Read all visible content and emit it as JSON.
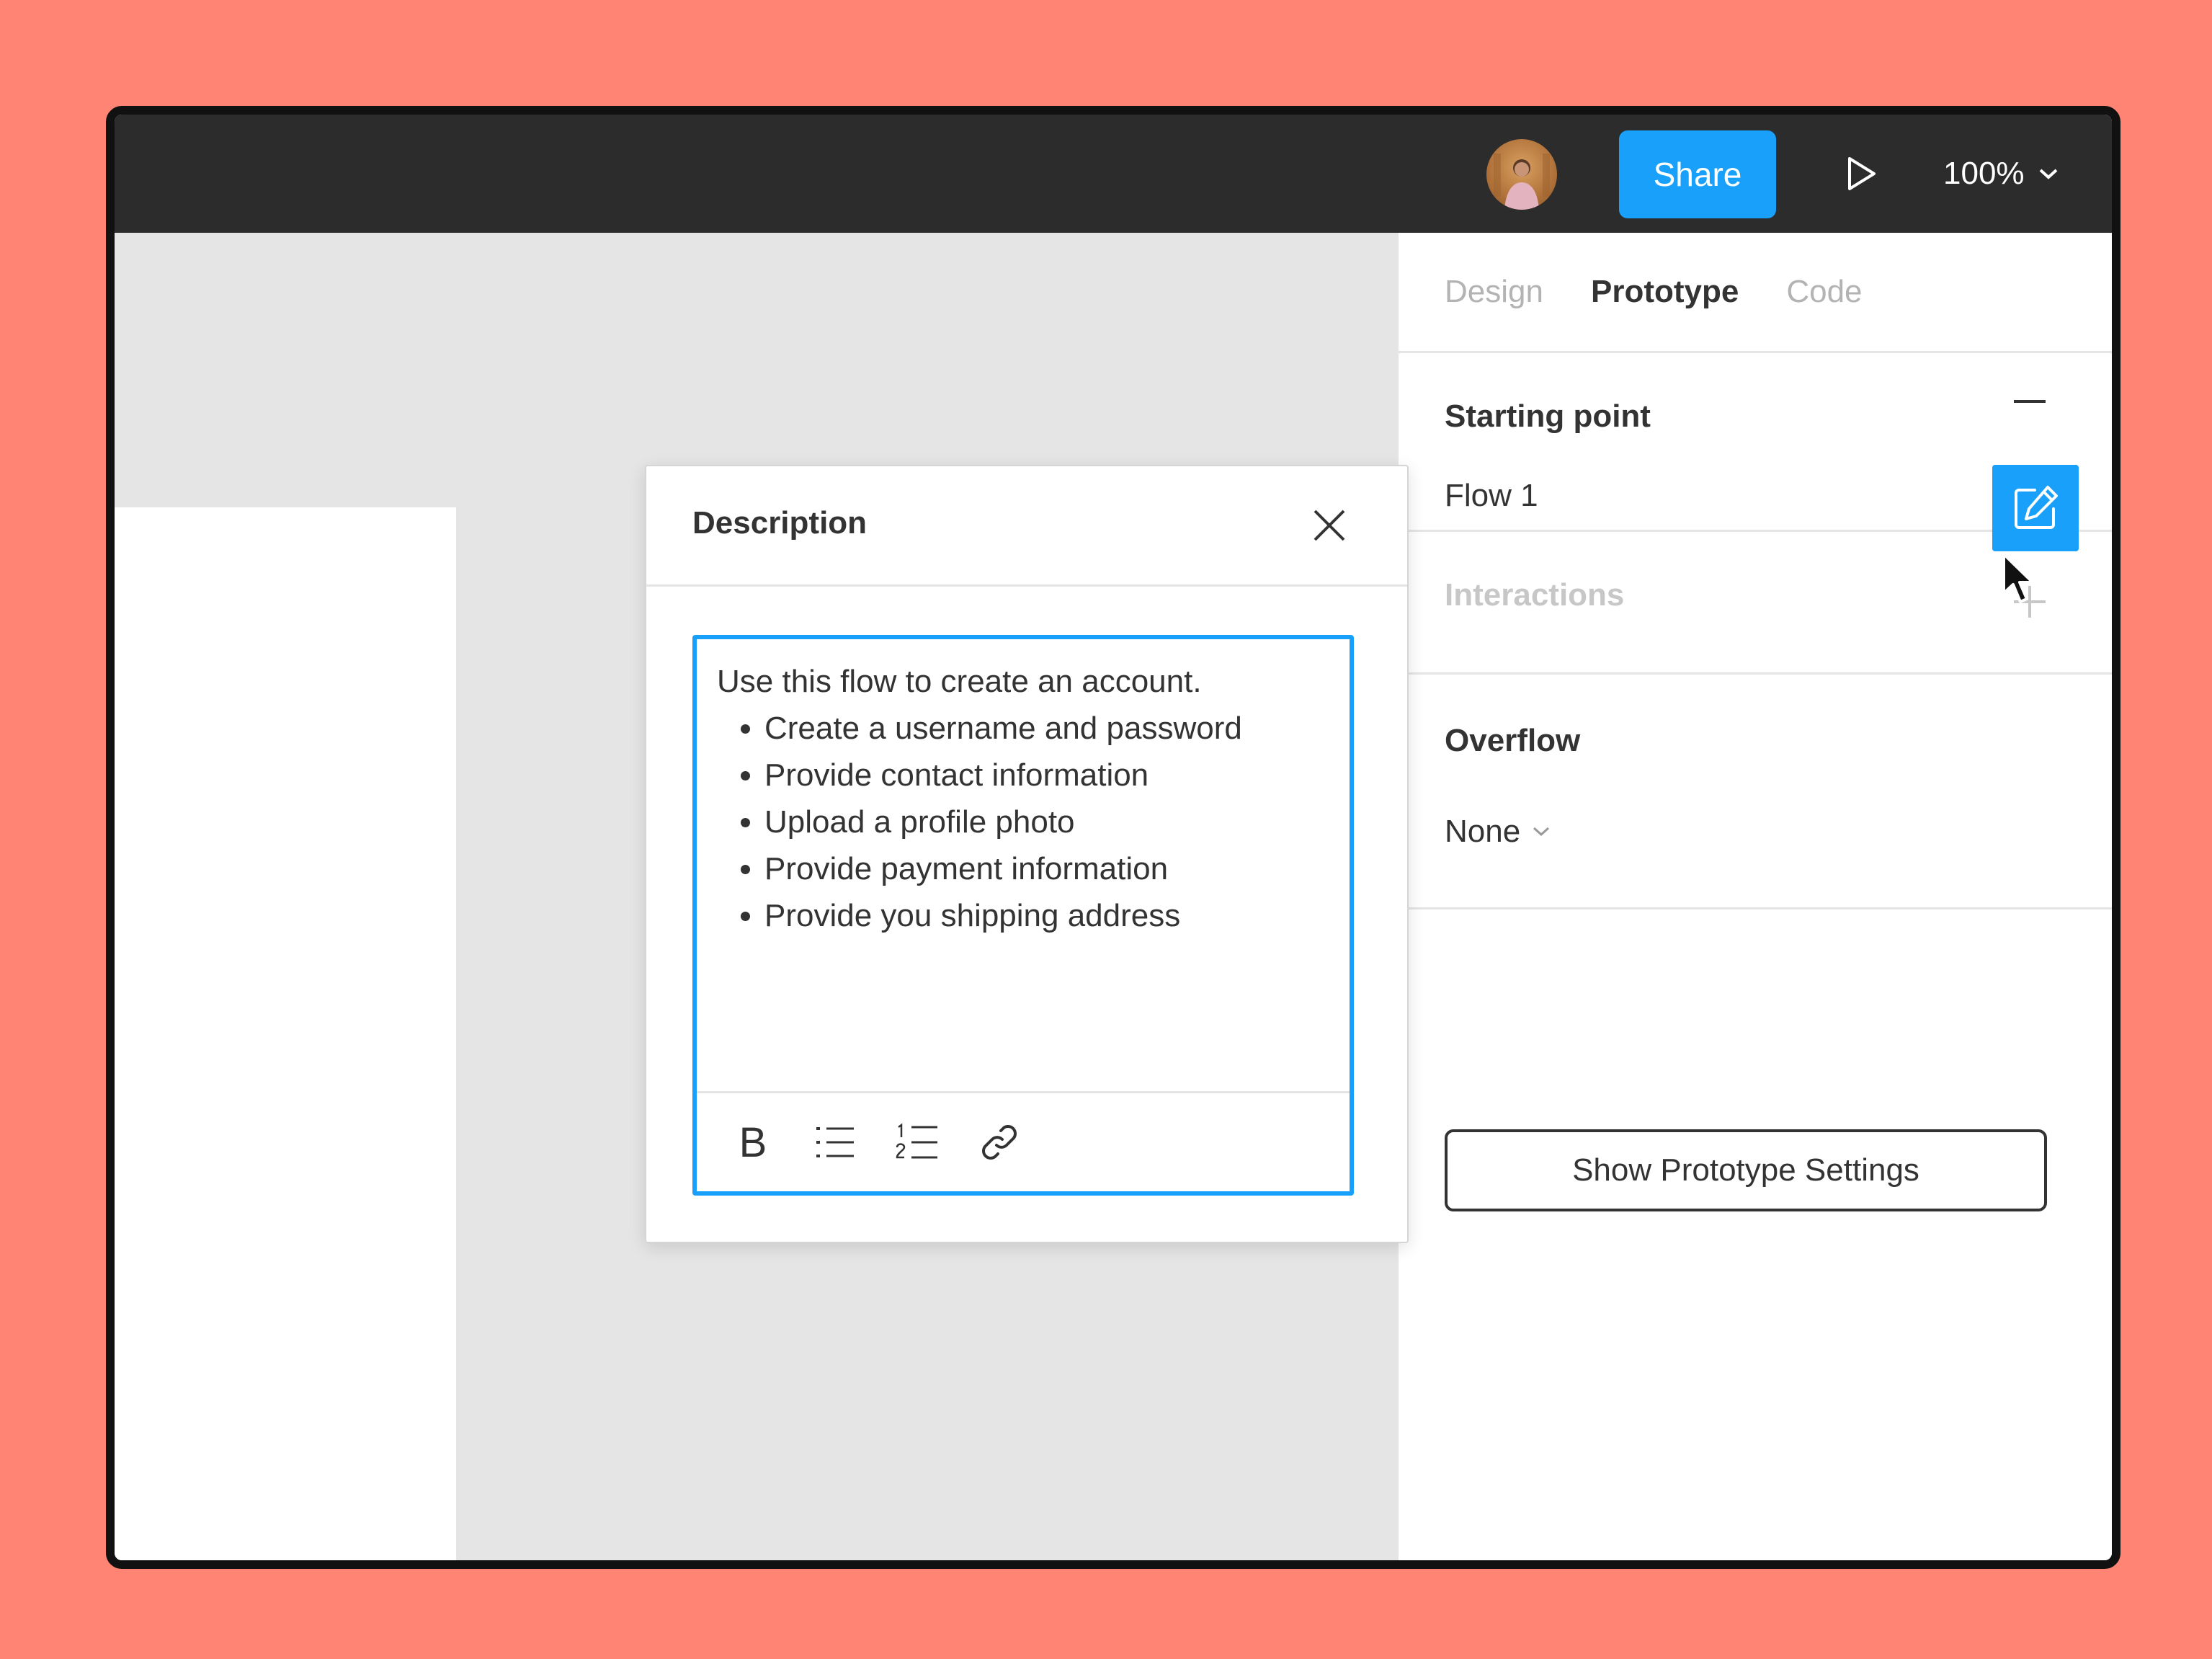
{
  "topbar": {
    "share_label": "Share",
    "zoom_value": "100%"
  },
  "panel": {
    "tabs": [
      {
        "label": "Design",
        "active": false
      },
      {
        "label": "Prototype",
        "active": true
      },
      {
        "label": "Code",
        "active": false
      }
    ],
    "starting_point": {
      "title": "Starting point",
      "flow_name": "Flow 1"
    },
    "interactions": {
      "title": "Interactions"
    },
    "overflow": {
      "title": "Overflow",
      "value": "None"
    },
    "show_settings_label": "Show Prototype Settings"
  },
  "dialog": {
    "title": "Description",
    "intro": "Use this flow to create an account.",
    "items": [
      "Create a username and password",
      "Provide contact information",
      "Upload a profile photo",
      "Provide payment information",
      "Provide you shipping address"
    ],
    "bold_label": "B"
  },
  "colors": {
    "background": "#FF8473",
    "accent": "#18A0FB",
    "topbar": "#2C2C2C",
    "canvas": "#E5E5E5"
  },
  "icons": [
    "avatar",
    "play-icon",
    "chevron-down-icon",
    "minus-icon",
    "edit-icon",
    "cursor-icon",
    "plus-icon",
    "close-icon",
    "bold-icon",
    "bullet-list-icon",
    "numbered-list-icon",
    "link-icon"
  ]
}
